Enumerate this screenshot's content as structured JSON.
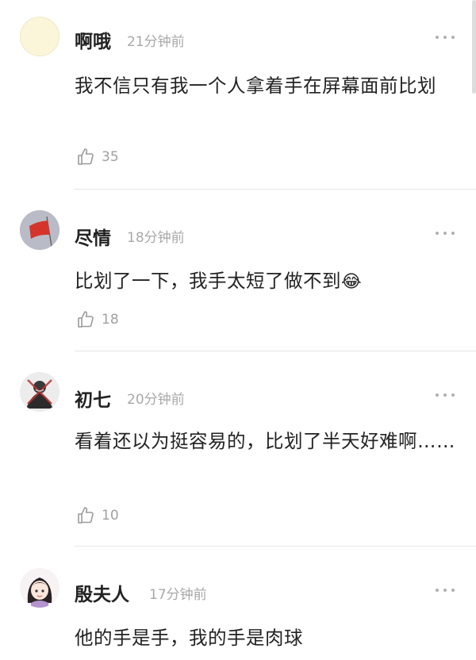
{
  "comments": [
    {
      "user": "啊哦",
      "time": "21分钟前",
      "text": "我不信只有我一个人拿着手在屏幕面前比划",
      "likes": "35",
      "avatar": "blank-avatar"
    },
    {
      "user": "尽情",
      "time": "18分钟前",
      "text": "比划了一下，我手太短了做不到",
      "emoji": "😂",
      "likes": "18",
      "avatar": "red-flag-avatar"
    },
    {
      "user": "初七",
      "time": "20分钟前",
      "text": "看着还以为挺容易的，比划了半天好难啊……",
      "likes": "10",
      "avatar": "dark-figure-avatar"
    },
    {
      "user": "殷夫人",
      "time": "17分钟前",
      "text": "他的手是手，我的手是肉球",
      "avatar": "cartoon-girl-avatar"
    }
  ],
  "colors": {
    "name": "#222222",
    "meta": "#a8a8a8",
    "divider": "#e6e6e6"
  }
}
